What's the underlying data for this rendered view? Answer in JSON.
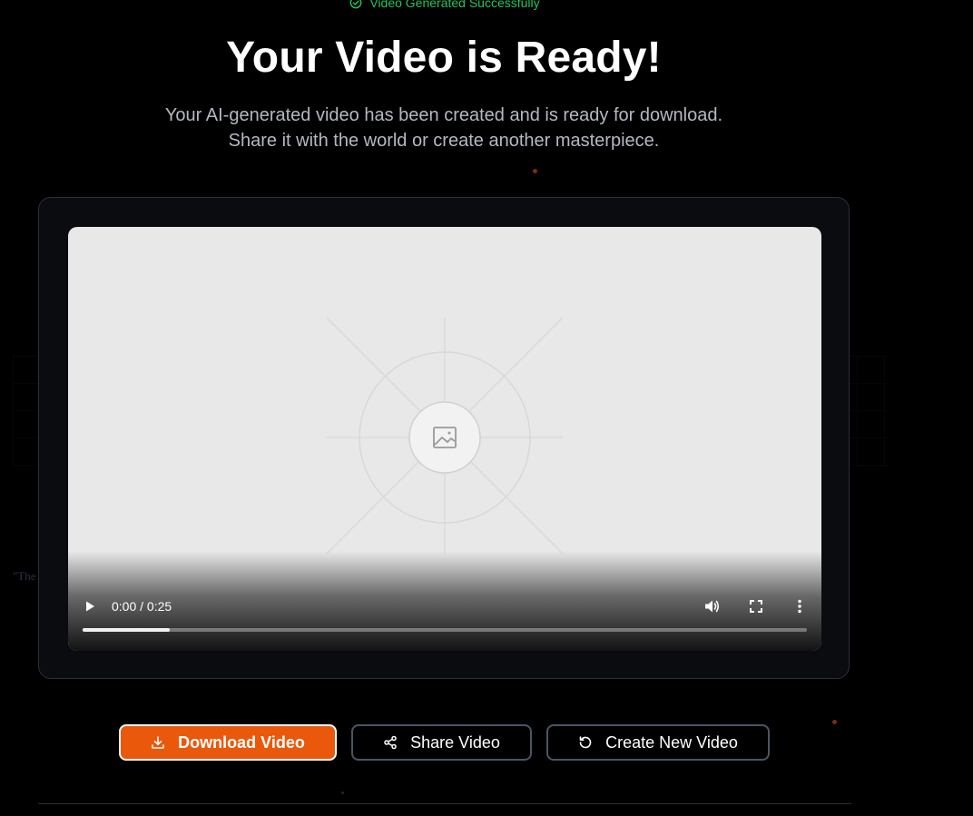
{
  "status": {
    "label": "Video Generated Successfully",
    "icon": "check-circle-icon",
    "color": "#22c55e"
  },
  "header": {
    "title": "Your Video is Ready!",
    "subtitle_line1": "Your AI-generated video has been created and is ready for download.",
    "subtitle_line2": "Share it with the world or create another masterpiece."
  },
  "background": {
    "caption": "\"The End\""
  },
  "player": {
    "current_time": "0:00",
    "duration": "0:25",
    "time_display": "0:00 / 0:25",
    "progress_buffered": 0.12,
    "poster_icon": "image-placeholder-icon",
    "controls": {
      "play_icon": "play-icon",
      "volume_icon": "volume-icon",
      "fullscreen_icon": "fullscreen-icon",
      "more_icon": "more-vertical-icon"
    }
  },
  "actions": {
    "download_label": "Download Video",
    "download_icon": "download-icon",
    "share_label": "Share Video",
    "share_icon": "share-icon",
    "create_label": "Create New Video",
    "create_icon": "refresh-icon"
  },
  "colors": {
    "accent": "#ea580c",
    "background": "#000000",
    "card": "#0a0c10",
    "card_border": "#2b2f3a",
    "subtitle": "#b4b8c2"
  }
}
